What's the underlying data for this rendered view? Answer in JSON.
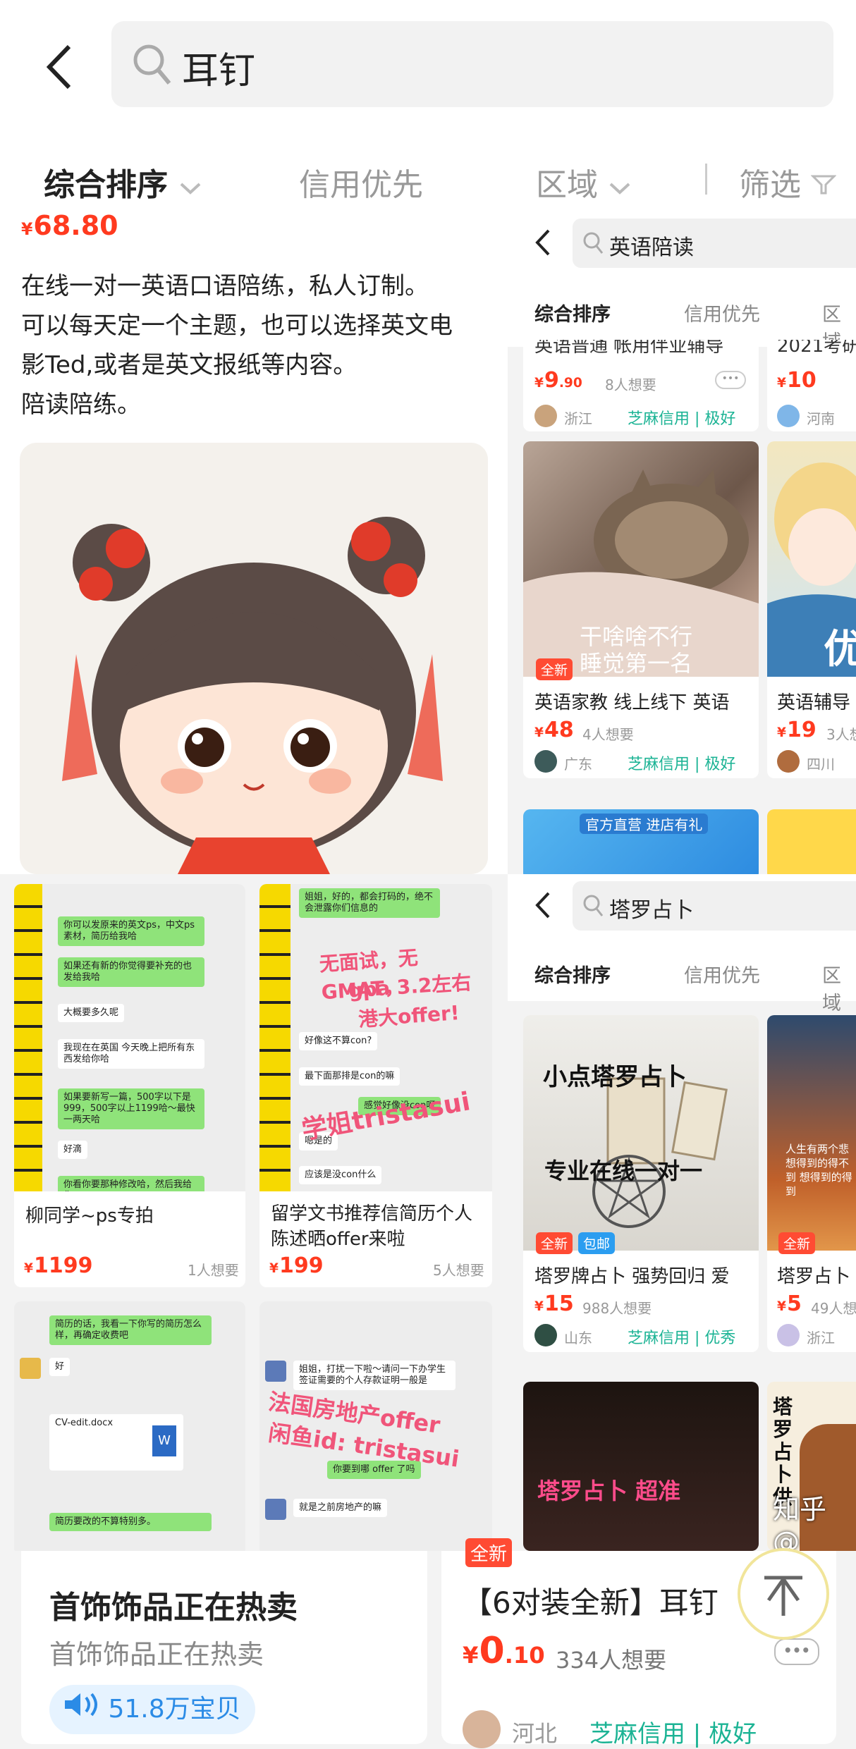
{
  "search": {
    "query": "耳钉"
  },
  "sort_tabs": {
    "comprehensive": "综合排序",
    "credit": "信用优先",
    "region": "区域",
    "filter": "筛选"
  },
  "left_top": {
    "price": "68.80",
    "currency": "¥",
    "desc_lines": [
      "在线一对一英语口语陪练，私人订制。",
      "可以每天定一个主题，也可以选择英文电",
      "影Ted,或者是英文报纸等内容。",
      "陪读陪练。"
    ]
  },
  "right_top": {
    "query": "英语陪读",
    "tabs": {
      "comprehensive": "综合排序",
      "credit": "信用优先",
      "region": "区域"
    },
    "row1": {
      "left": {
        "title_frag": "英语普通 帐用伴业辅导",
        "price_int": "9",
        "price_dec": ".90",
        "wants": "8人想要",
        "location": "浙江",
        "credit": "芝麻信用 | 极好"
      },
      "right": {
        "title_frag": "2021考研",
        "price_int": "10",
        "location": "河南"
      }
    },
    "card1": {
      "caption_line1": "干啥啥不行",
      "caption_line2": "睡觉第一名",
      "badge": "全新",
      "title": "英语家教 线上线下 英语",
      "price": "48",
      "wants": "4人想要",
      "location": "广东",
      "credit": "芝麻信用 | 极好"
    },
    "card2": {
      "title": "英语辅导",
      "price": "19",
      "wants": "3人想",
      "location": "四川",
      "overlay": "优"
    },
    "banner": {
      "text": "官方直营 进店有礼"
    }
  },
  "left_bottom": {
    "card1": {
      "title": "柳同学~ps专拍",
      "price": "1199",
      "wants": "1人想要",
      "chat": [
        "你可以发原来的英文ps，中文ps素材，简历给我哈",
        "如果还有新的你觉得要补充的也发给我哈",
        "大概要多久呢",
        "我现在在英国 今天晚上把所有东西发给你哈",
        "如果要新写一篇，500字以下是999，500字以上1199哈～最快一两天哈",
        "好滴",
        "你看你要那种修改哈，然后我给你"
      ]
    },
    "card2": {
      "title": "留学文书推荐信简历个人陈述晒offer来啦",
      "price": "199",
      "wants": "5人想要",
      "chat": [
        "姐姐，好的，都会打码的，绝不会泄露你们信息的",
        "好像这不算con?",
        "最下面那排是con的嘛",
        "感觉好像没con呀",
        "嗯是的",
        "应该是没con什么"
      ],
      "overlay1": "无面试，无GMAT，",
      "overlay2": "gpa 3.2左右",
      "overlay3": "港大offer!",
      "overlay4": "学姐tristasui"
    },
    "card3": {
      "chat": [
        "简历的话，我看一下你写的简历怎么样，再确定收费吧",
        "好",
        "简历要改的不算特别多。"
      ],
      "file": "CV-edit.docx"
    },
    "card4": {
      "chat": [
        "姐姐，打扰一下啦～请问一下办学生签证需要的个人存款证明一般是",
        "你要到哪 offer 了吗",
        "就是之前房地产的嘛"
      ],
      "overlay1": "法国房地产offer",
      "overlay2": "闲鱼id: tristasui"
    }
  },
  "right_bottom": {
    "query": "塔罗占卜",
    "tabs": {
      "comprehensive": "综合排序",
      "credit": "信用优先",
      "region": "区域"
    },
    "card1": {
      "img_line1": "小点塔罗占卜",
      "img_line2": "专业在线一对一",
      "badges": [
        "全新",
        "包邮"
      ],
      "title": "塔罗牌占卜 强势回归 爱",
      "price": "15",
      "wants": "988人想要",
      "location": "山东",
      "credit": "芝麻信用 | 优秀"
    },
    "card2": {
      "badge": "全新",
      "title": "塔罗占卜",
      "price": "5",
      "wants": "49人想",
      "location": "浙江",
      "img_text": "人生有两个悲 想得到的得不到 想得到的得到"
    },
    "card3": {
      "img_text": "塔罗占卜 超准"
    },
    "card4": {
      "img_text": "塔罗占卜供"
    }
  },
  "bottom": {
    "hot_title": "首饰饰品正在热卖",
    "hot_sub": "首饰饰品正在热卖",
    "hot_count": "51.8万宝贝",
    "product_title": "【6对装全新】耳钉",
    "product_price_int": "0",
    "product_price_dec": ".10",
    "product_wants": "334人想要",
    "product_location": "河北",
    "product_credit": "芝麻信用 | 极好",
    "badge_frag": "全新"
  },
  "watermark": "知乎 @"
}
